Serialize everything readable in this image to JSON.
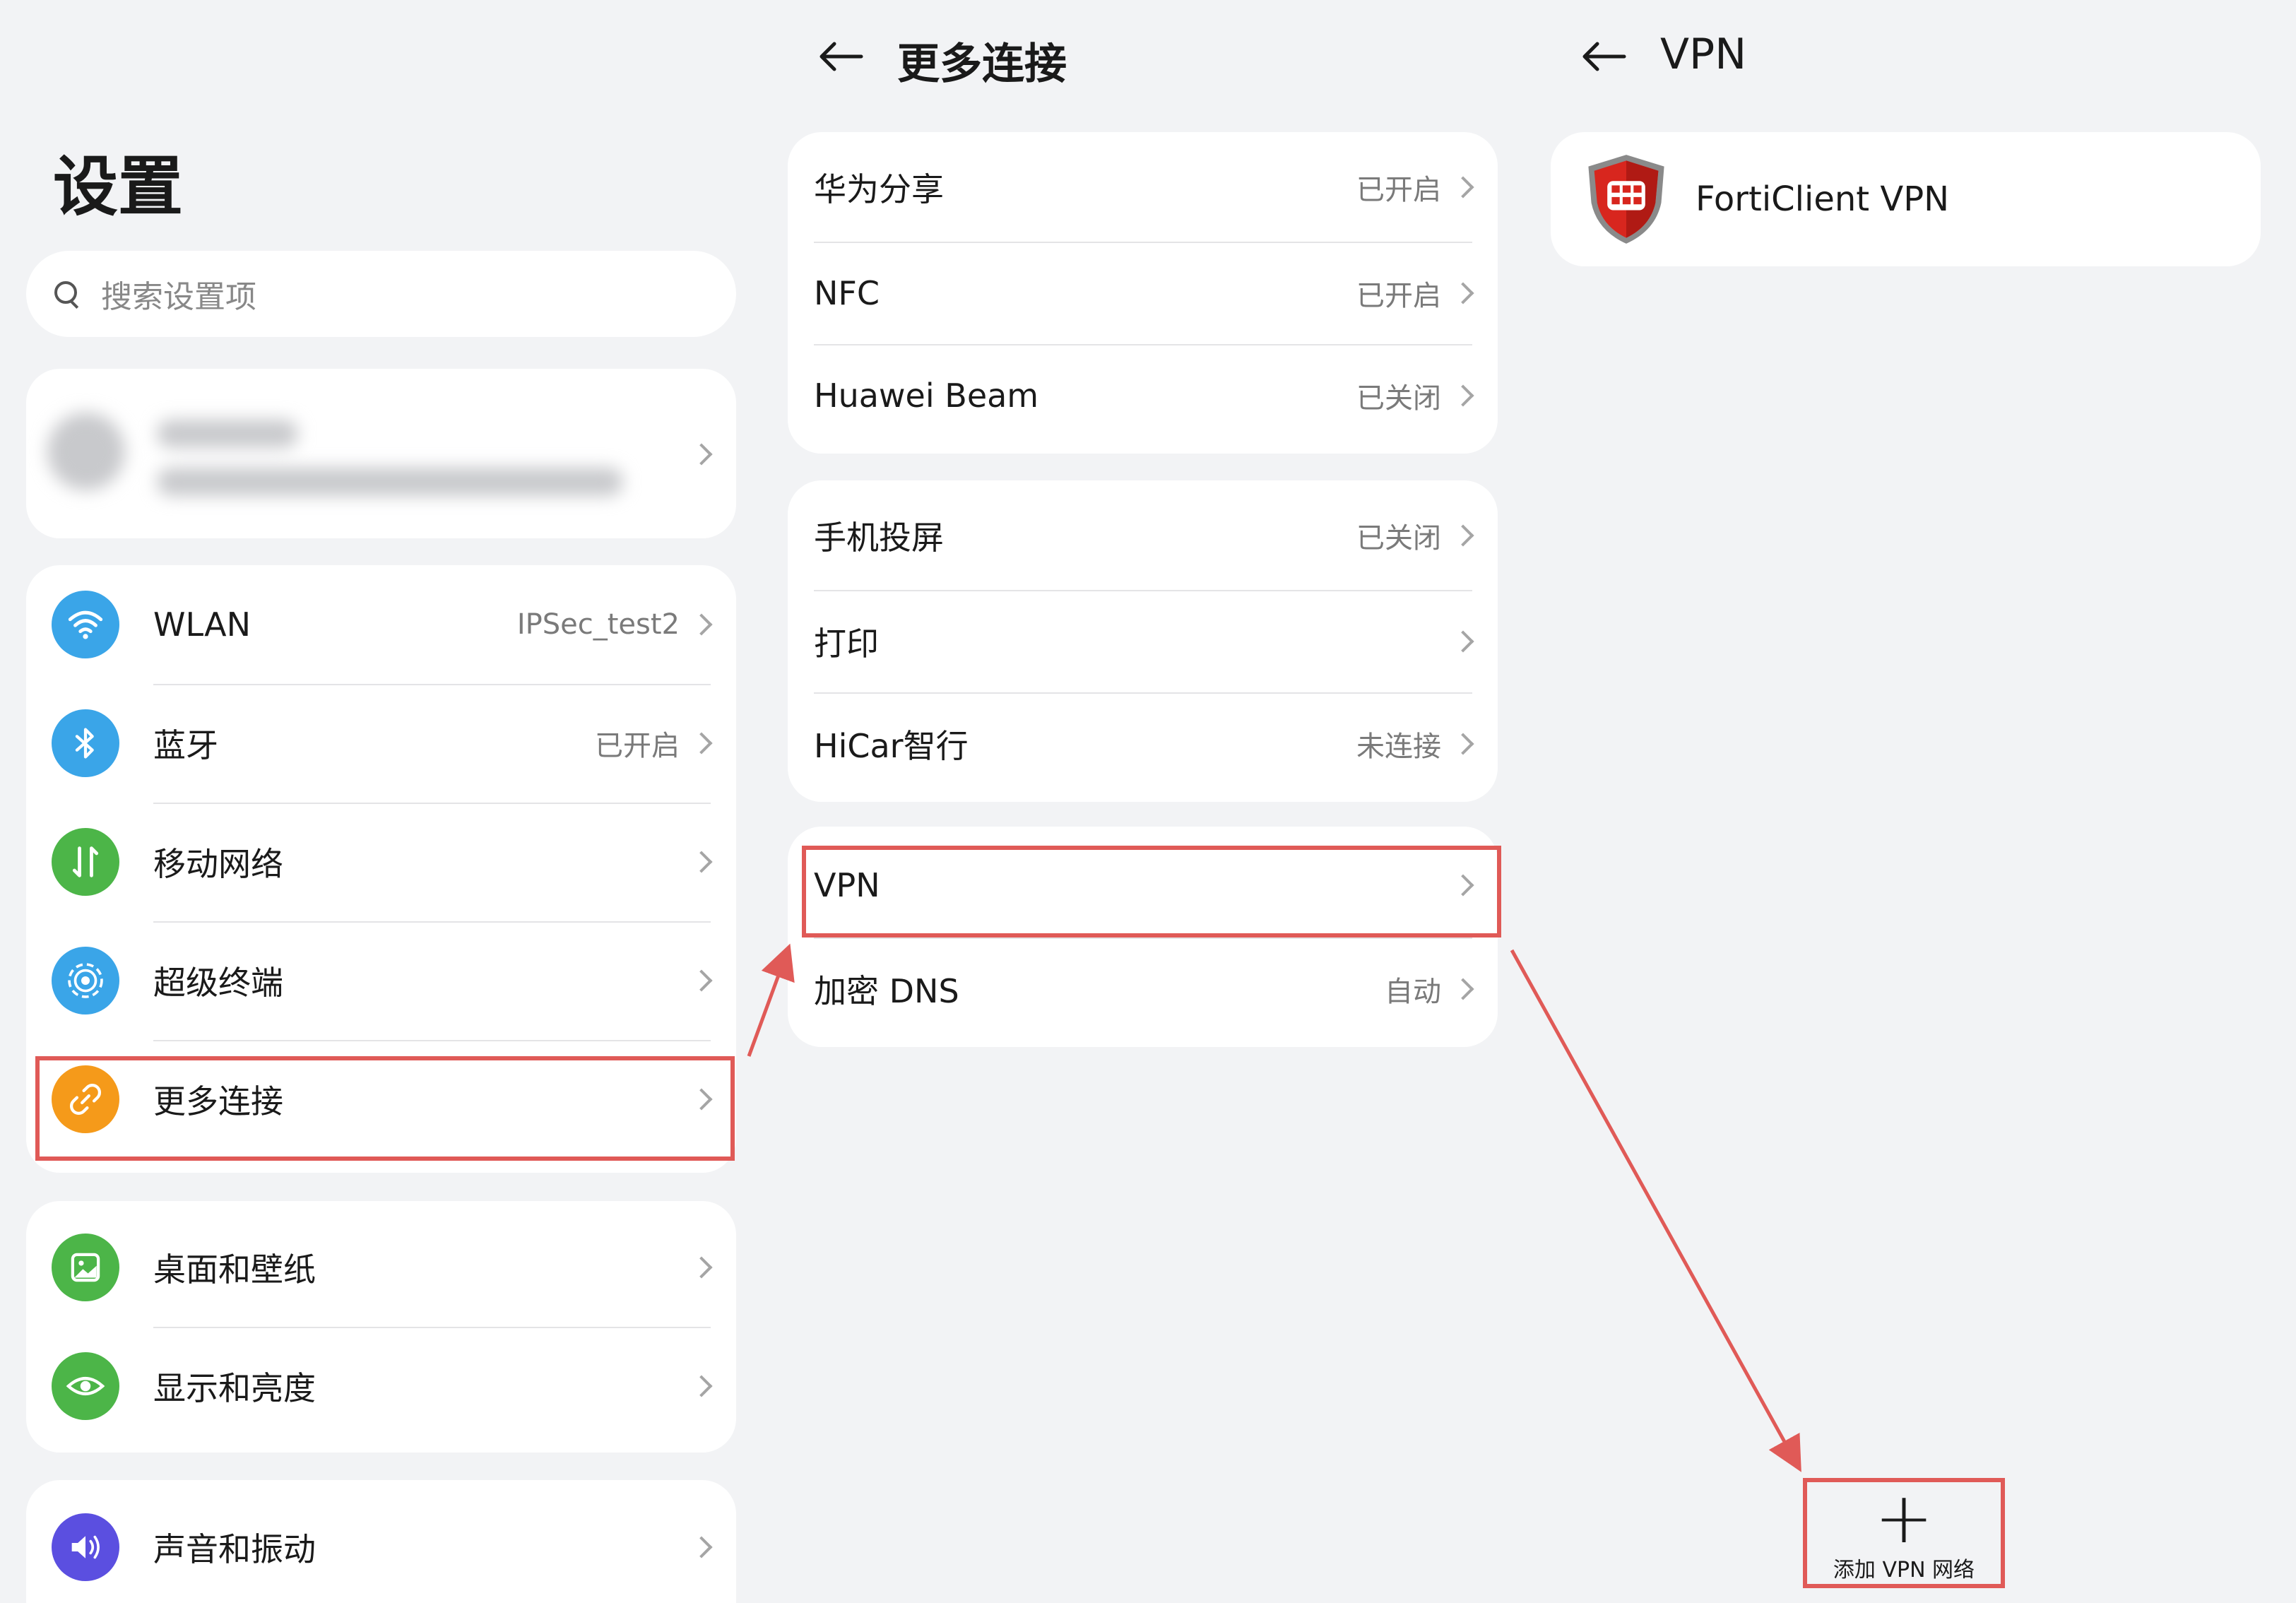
{
  "left": {
    "title": "设置",
    "search_placeholder": "搜索设置项",
    "group1": [
      {
        "label": "WLAN",
        "value": "IPSec_test2"
      },
      {
        "label": "蓝牙",
        "value": "已开启"
      },
      {
        "label": "移动网络",
        "value": ""
      },
      {
        "label": "超级终端",
        "value": ""
      },
      {
        "label": "更多连接",
        "value": ""
      }
    ],
    "group2": [
      {
        "label": "桌面和壁纸",
        "value": ""
      },
      {
        "label": "显示和亮度",
        "value": ""
      }
    ],
    "group3": [
      {
        "label": "声音和振动",
        "value": ""
      }
    ]
  },
  "middle": {
    "title": "更多连接",
    "group1": [
      {
        "label": "华为分享",
        "value": "已开启"
      },
      {
        "label": "NFC",
        "value": "已开启"
      },
      {
        "label": "Huawei Beam",
        "value": "已关闭"
      }
    ],
    "group2": [
      {
        "label": "手机投屏",
        "value": "已关闭"
      },
      {
        "label": "打印",
        "value": ""
      },
      {
        "label": "HiCar智行",
        "value": "未连接"
      }
    ],
    "group3": [
      {
        "label": "VPN",
        "value": ""
      },
      {
        "label": "加密 DNS",
        "value": "自动"
      }
    ]
  },
  "right": {
    "title": "VPN",
    "app_name": "FortiClient VPN",
    "add_label": "添加 VPN 网络"
  },
  "colors": {
    "wlan": "#3aa5e8",
    "bluetooth": "#3aa5e8",
    "mobile": "#4cb548",
    "superdevice": "#3aa5e8",
    "more": "#f59a1a",
    "desktop": "#4cb548",
    "display": "#4cb548",
    "sound": "#5b4fe0",
    "highlight": "#e05a57"
  }
}
